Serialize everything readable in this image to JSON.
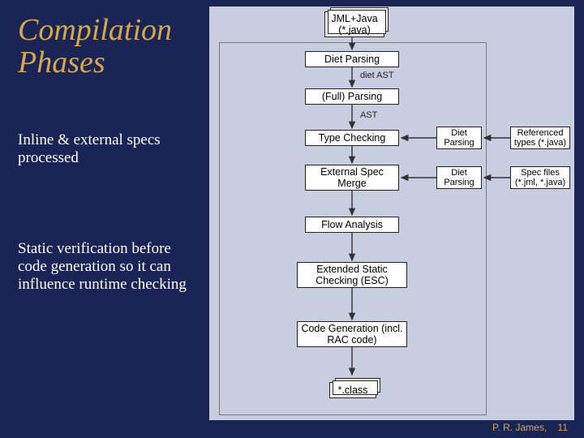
{
  "title_line1": "Compilation",
  "title_line2": "Phases",
  "note1": "Inline & external specs processed",
  "note2": "Static verification before code generation so it can influence runtime checking",
  "footer_author": "P. R. James,",
  "footer_page": "11",
  "boxes": {
    "input": "JML+Java\n(*.java)",
    "diet": "Diet Parsing",
    "full": "(Full) Parsing",
    "type": "Type Checking",
    "merge": "External Spec Merge",
    "flow": "Flow Analysis",
    "esc": "Extended Static Checking (ESC)",
    "codegen": "Code Generation (incl. RAC code)",
    "output": "*.class"
  },
  "sideboxes": {
    "diet1": "Diet Parsing",
    "diet2": "Diet Parsing",
    "ref": "Referenced types (*.java)",
    "spec": "Spec files (*.jml, *.java)"
  },
  "edge_labels": {
    "diet_ast": "diet AST",
    "ast": "AST"
  },
  "chart_data": {
    "type": "flowchart",
    "nodes": [
      {
        "id": "input",
        "label": "JML+Java (*.java)",
        "kind": "file-stack"
      },
      {
        "id": "diet",
        "label": "Diet Parsing"
      },
      {
        "id": "full",
        "label": "(Full) Parsing"
      },
      {
        "id": "type",
        "label": "Type Checking"
      },
      {
        "id": "merge",
        "label": "External Spec Merge"
      },
      {
        "id": "flow",
        "label": "Flow Analysis"
      },
      {
        "id": "esc",
        "label": "Extended Static Checking (ESC)"
      },
      {
        "id": "codegen",
        "label": "Code Generation (incl. RAC code)"
      },
      {
        "id": "output",
        "label": "*.class",
        "kind": "file-stack"
      },
      {
        "id": "dietp1",
        "label": "Diet Parsing",
        "kind": "side"
      },
      {
        "id": "dietp2",
        "label": "Diet Parsing",
        "kind": "side"
      },
      {
        "id": "ref",
        "label": "Referenced types (*.java)",
        "kind": "input"
      },
      {
        "id": "spec",
        "label": "Spec files (*.jml, *.java)",
        "kind": "input"
      }
    ],
    "edges": [
      {
        "from": "input",
        "to": "diet"
      },
      {
        "from": "diet",
        "to": "full",
        "label": "diet AST"
      },
      {
        "from": "full",
        "to": "type",
        "label": "AST"
      },
      {
        "from": "type",
        "to": "merge"
      },
      {
        "from": "merge",
        "to": "flow"
      },
      {
        "from": "flow",
        "to": "esc"
      },
      {
        "from": "esc",
        "to": "codegen"
      },
      {
        "from": "codegen",
        "to": "output"
      },
      {
        "from": "ref",
        "to": "dietp1"
      },
      {
        "from": "dietp1",
        "to": "type"
      },
      {
        "from": "spec",
        "to": "dietp2"
      },
      {
        "from": "dietp2",
        "to": "merge"
      }
    ],
    "annotations": [
      {
        "text": "Inline & external specs processed",
        "targets": [
          "type",
          "merge"
        ]
      },
      {
        "text": "Static verification before code generation so it can influence runtime checking",
        "targets": [
          "esc"
        ]
      }
    ]
  }
}
